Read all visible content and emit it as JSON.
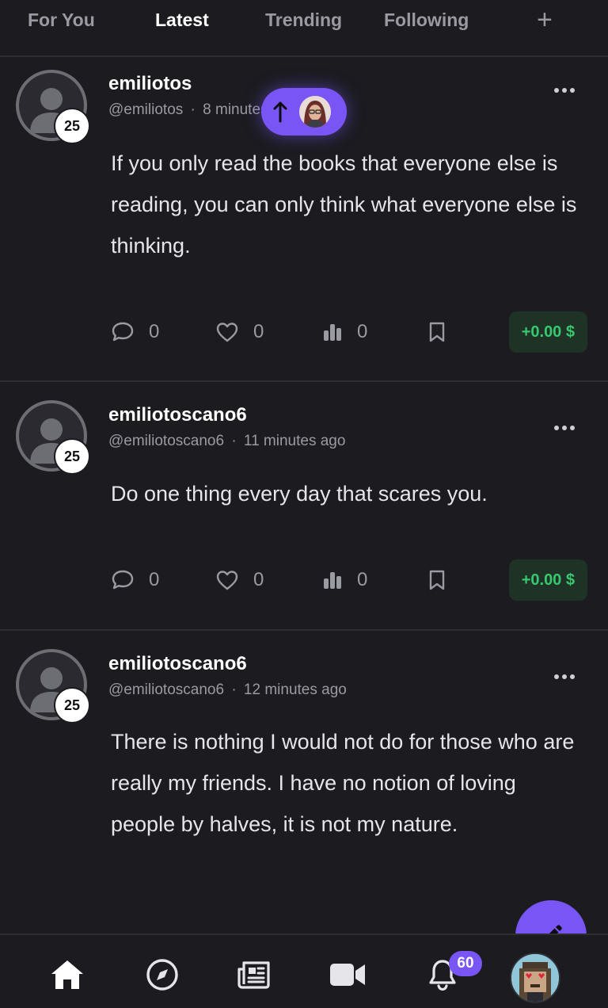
{
  "tabs": [
    {
      "label": "For You"
    },
    {
      "label": "Latest"
    },
    {
      "label": "Trending"
    },
    {
      "label": "Following"
    }
  ],
  "tab_add_label": "+",
  "active_tab": "Latest",
  "colors": {
    "background": "#1b1b20",
    "accent": "#7a55f5",
    "payout_bg": "#1f3226",
    "payout_text": "#37c870",
    "muted": "#9a9aa2"
  },
  "posts": [
    {
      "author": "emiliotos",
      "handle": "@emiliotos",
      "time": "8 minutes ago",
      "reputation": "25",
      "text": "If you only read the books that everyone else is reading, you can only think what everyone else is thinking.",
      "comments": "0",
      "likes": "0",
      "views": "0",
      "payout": "+0.00 $"
    },
    {
      "author": "emiliotoscano6",
      "handle": "@emiliotoscano6",
      "time": "11 minutes ago",
      "reputation": "25",
      "text": "Do one thing every day that scares you.",
      "comments": "0",
      "likes": "0",
      "views": "0",
      "payout": "+0.00 $"
    },
    {
      "author": "emiliotoscano6",
      "handle": "@emiliotoscano6",
      "time": "12 minutes ago",
      "reputation": "25",
      "text": "There is nothing I would not do for those who are really my friends. I have no notion of loving people by halves, it is not my nature."
    }
  ],
  "meta_separator": "·",
  "notifications_badge": "60",
  "icons": {
    "new_posts": "arrow-up-icon",
    "compose": "pencil-icon",
    "nav": [
      "home-icon",
      "compass-icon",
      "newspaper-icon",
      "video-icon",
      "bell-icon"
    ]
  }
}
